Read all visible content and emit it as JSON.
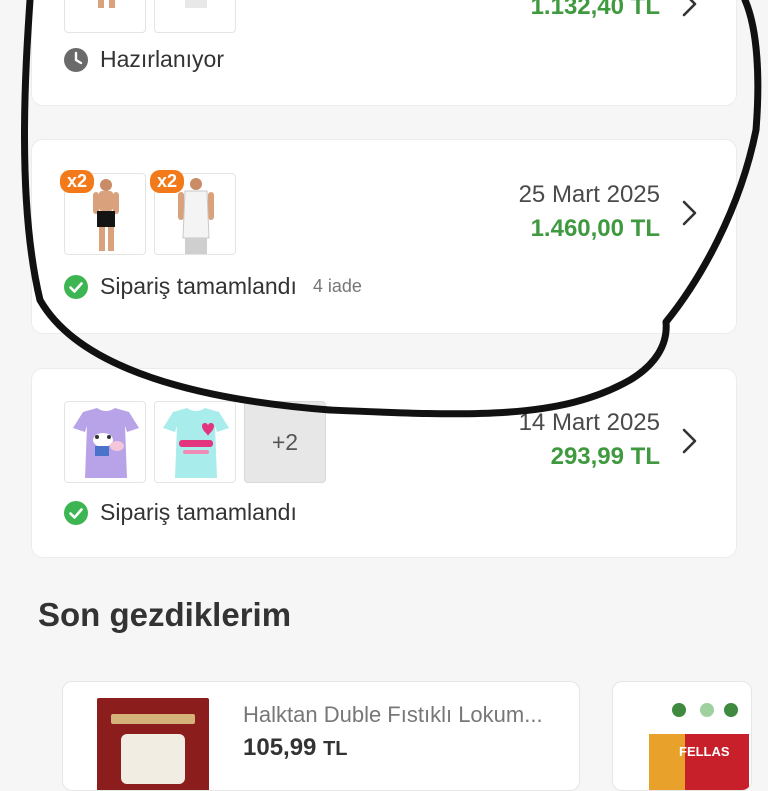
{
  "orders": [
    {
      "price": "1.132,40 TL",
      "status": "Hazırlanıyor",
      "status_icon": "clock-icon"
    },
    {
      "date": "25 Mart 2025",
      "price": "1.460,00 TL",
      "status": "Sipariş tamamlandı",
      "status_icon": "check-circle-icon",
      "sub_status": "4 iade",
      "items": [
        {
          "qty_badge": "x2",
          "product": "black boxer"
        },
        {
          "qty_badge": "x2",
          "product": "white undershirt"
        }
      ]
    },
    {
      "date": "14 Mart 2025",
      "price": "293,99 TL",
      "status": "Sipariş tamamlandı",
      "status_icon": "check-circle-icon",
      "more_items": "+2",
      "items": [
        {
          "product": "lilac kids t-shirt"
        },
        {
          "product": "mint kids t-shirt"
        }
      ]
    }
  ],
  "recently_viewed": {
    "title": "Son gezdiklerim",
    "items": [
      {
        "name": "Halktan Duble Fıstıklı Lokum...",
        "price": "105,99",
        "currency": "TL"
      },
      {
        "brand": "FELLAS"
      }
    ]
  },
  "colors": {
    "price_green": "#3f9a3f",
    "badge_orange": "#f27a1a",
    "check_green": "#3eb553",
    "annotation_ink": "#111111"
  }
}
